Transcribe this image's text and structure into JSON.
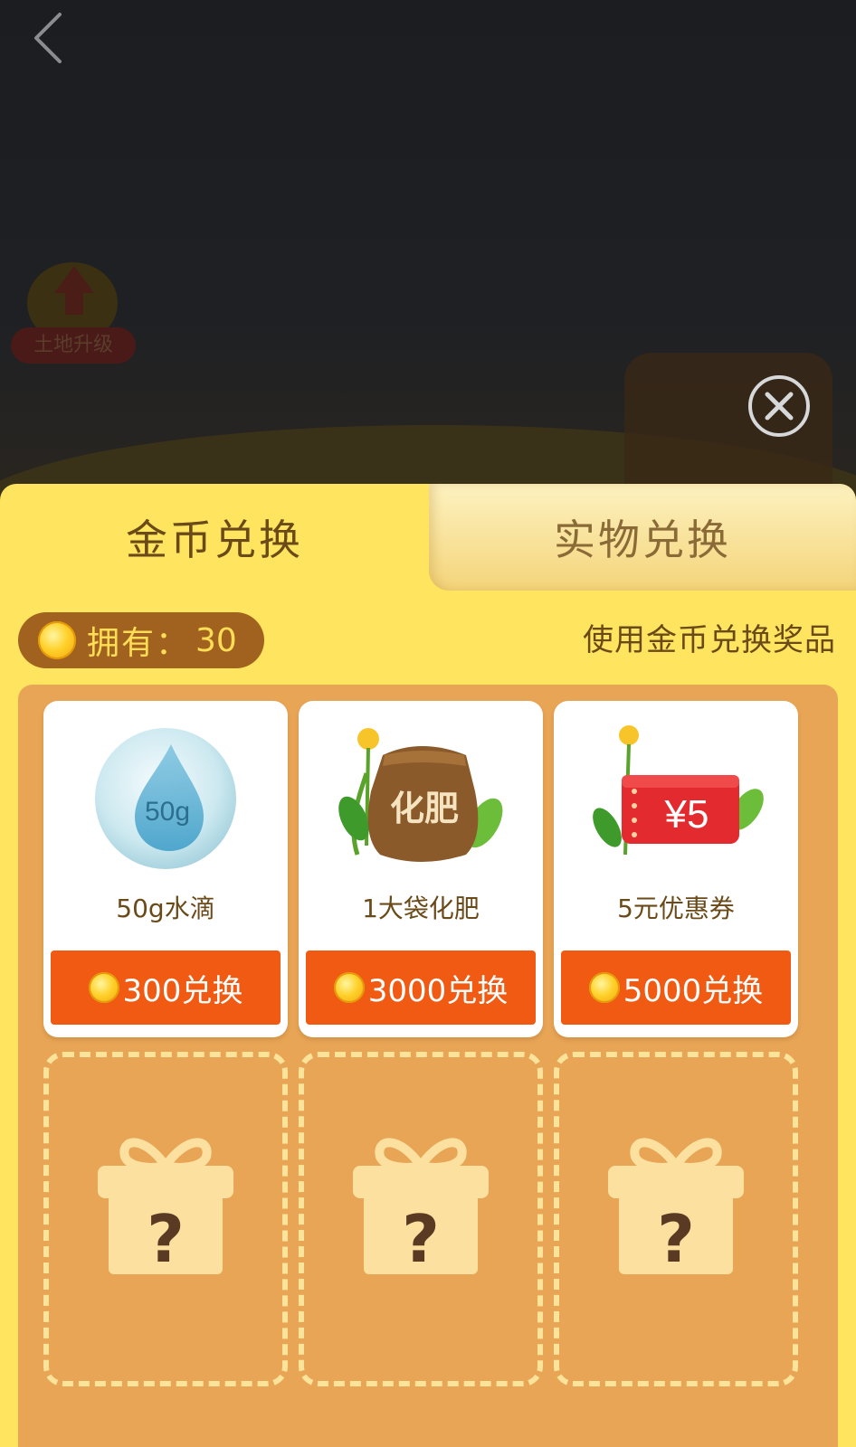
{
  "background": {
    "upgrade_label": "土地升级"
  },
  "tabs": [
    {
      "label": "金币兑换",
      "active": true
    },
    {
      "label": "实物兑换",
      "active": false
    }
  ],
  "balance": {
    "label": "拥有：",
    "value": "30"
  },
  "hint": "使用金币兑换奖品",
  "rewards": [
    {
      "name": "50g水滴",
      "icon": "water-drop-icon",
      "badge": "50g",
      "button": "300兑换"
    },
    {
      "name": "1大袋化肥",
      "icon": "fertilizer-bag-icon",
      "badge": "化肥",
      "button": "3000兑换"
    },
    {
      "name": "5元优惠券",
      "icon": "coupon-icon",
      "badge": "¥5",
      "button": "5000兑换"
    }
  ],
  "mystery_slots": [
    {
      "icon": "mystery-gift-icon",
      "mark": "?"
    },
    {
      "icon": "mystery-gift-icon",
      "mark": "?"
    },
    {
      "icon": "mystery-gift-icon",
      "mark": "?"
    }
  ],
  "colors": {
    "panel": "#ffe45f",
    "grid": "#e8a556",
    "button": "#f05a12",
    "balance_pill": "#a2621f"
  }
}
